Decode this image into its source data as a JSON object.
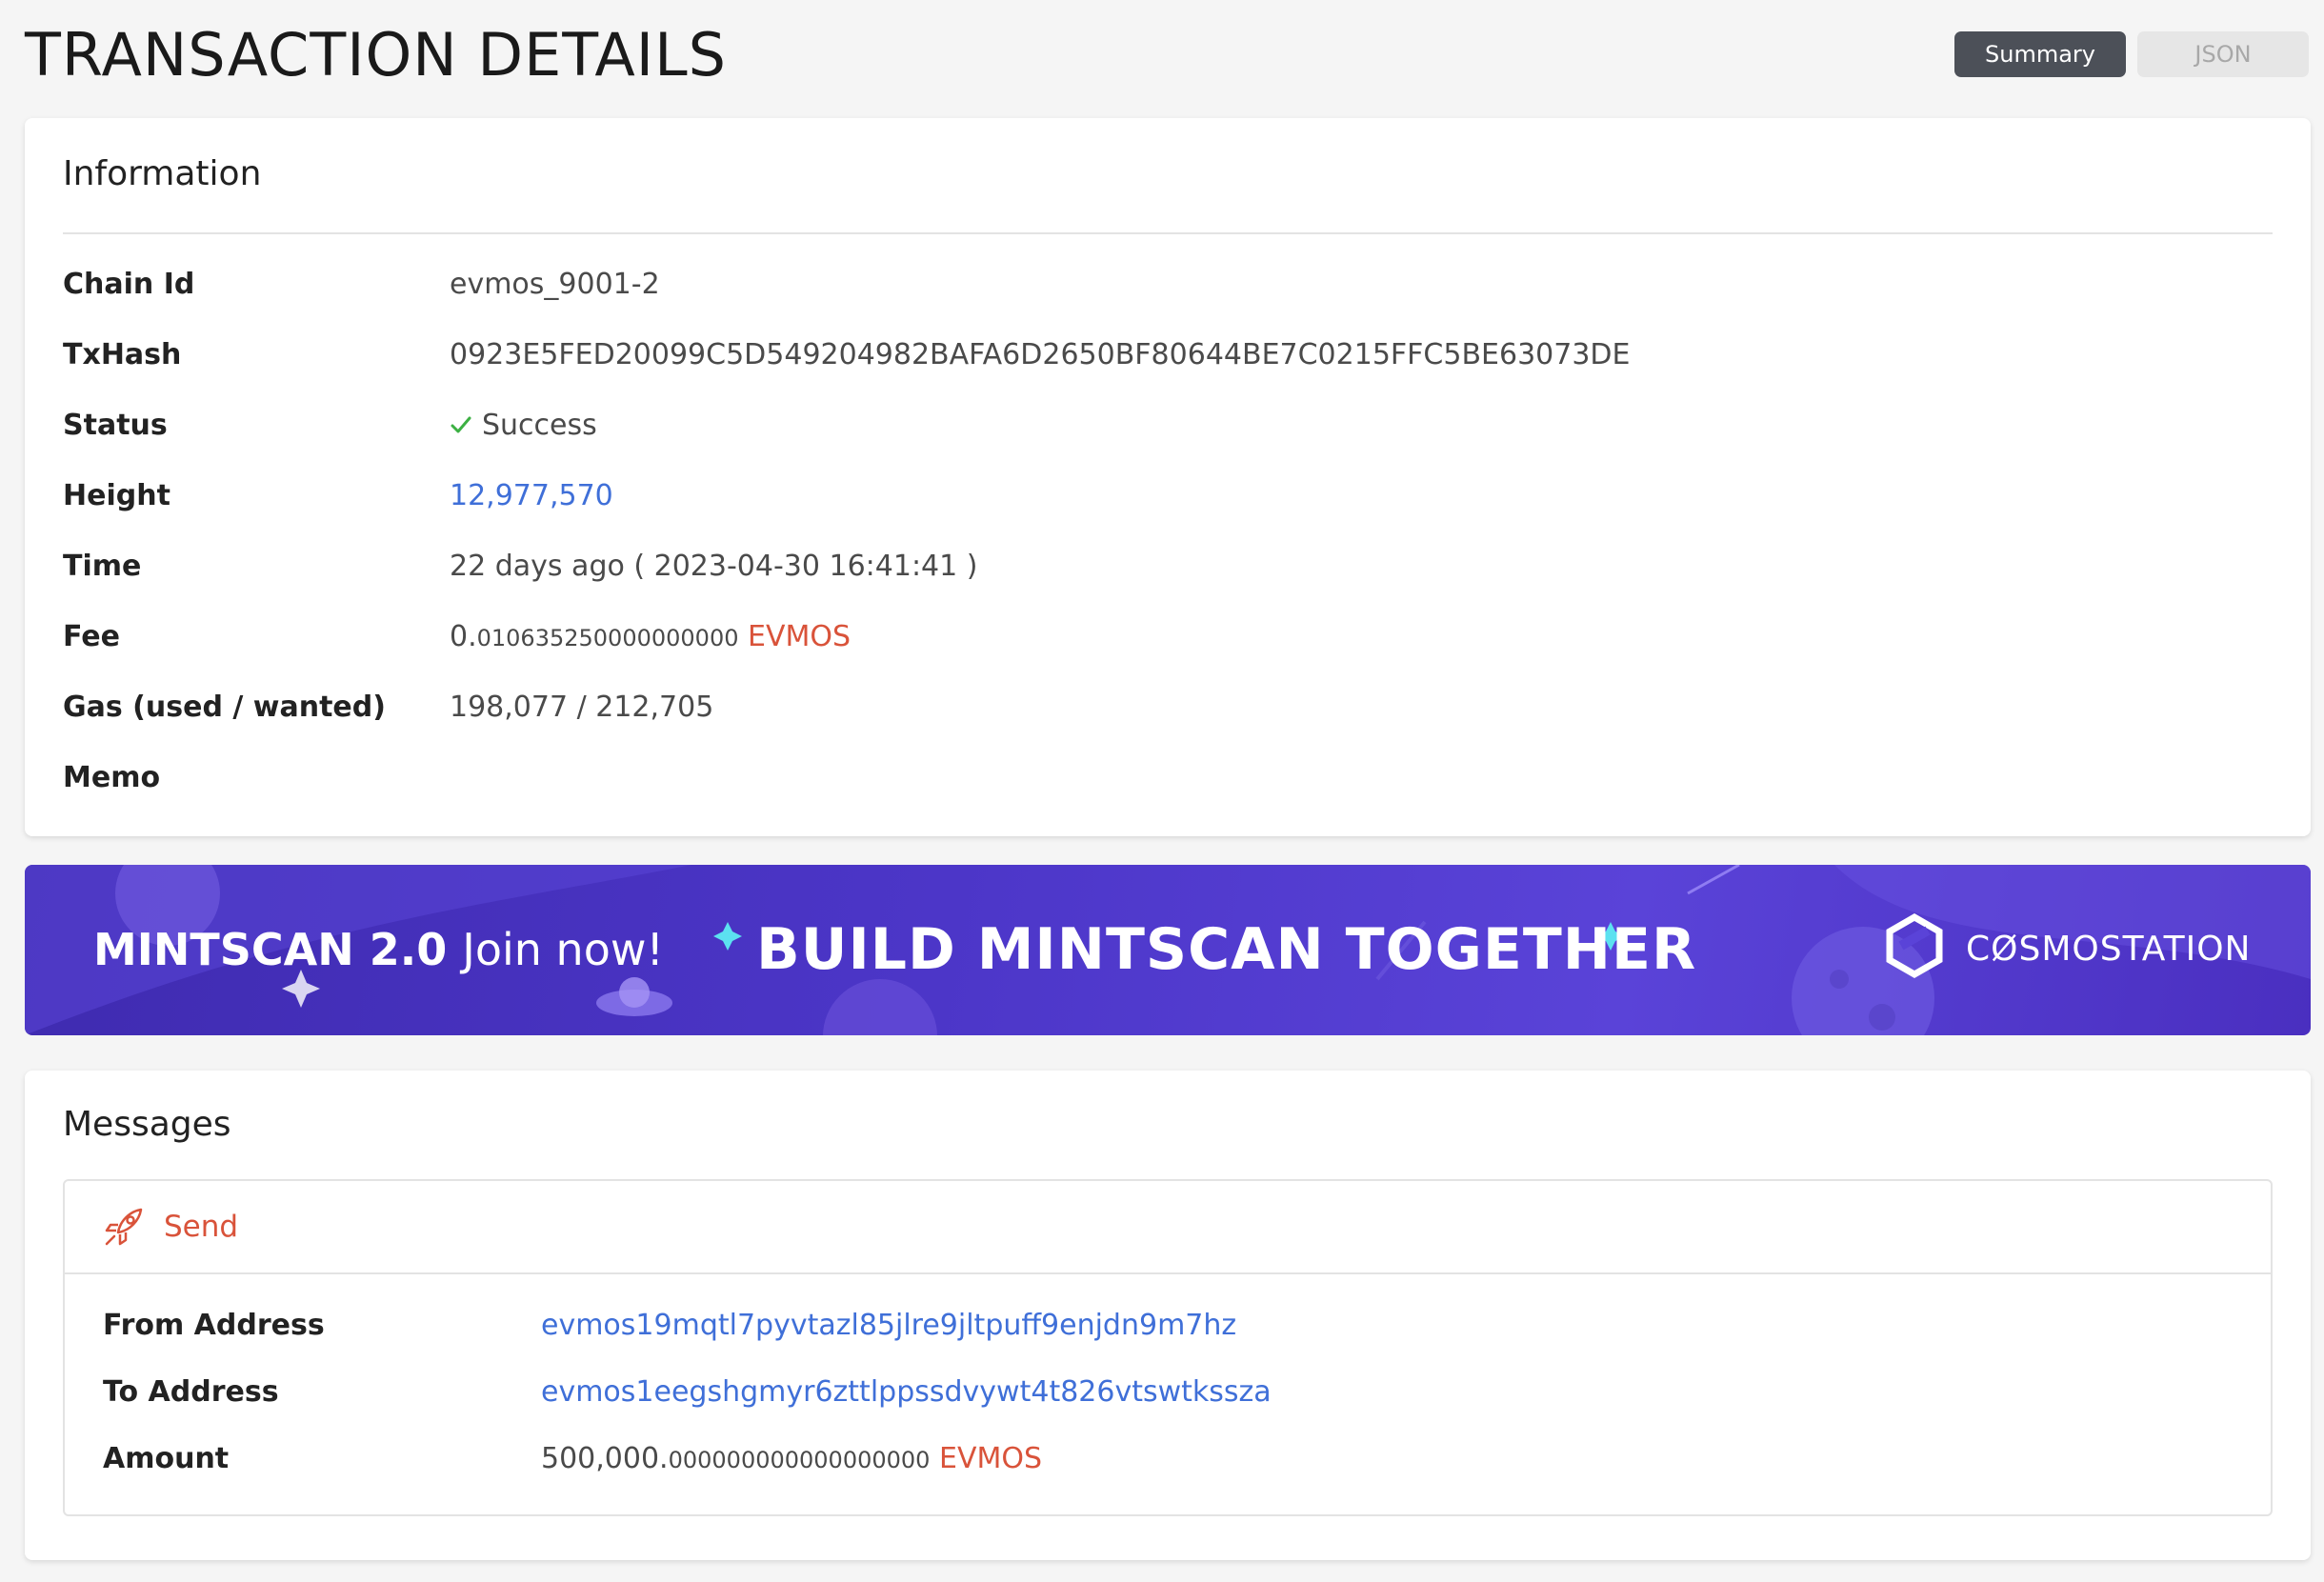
{
  "page": {
    "title": "TRANSACTION DETAILS"
  },
  "view_toggle": {
    "summary": "Summary",
    "json": "JSON",
    "active": "Summary"
  },
  "information": {
    "title": "Information",
    "rows": [
      {
        "label": "Chain Id",
        "value": "evmos_9001-2"
      },
      {
        "label": "TxHash",
        "value": "0923E5FED20099C5D549204982BAFA6D2650BF80644BE7C0215FFC5BE63073DE"
      },
      {
        "label": "Status",
        "value": "Success"
      },
      {
        "label": "Height",
        "value": "12,977,570"
      },
      {
        "label": "Time",
        "value": "22 days ago ( 2023-04-30 16:41:41 )"
      },
      {
        "label": "Fee",
        "value_int": "0.",
        "value_dec": "010635250000000000",
        "denom": "EVMOS"
      },
      {
        "label": "Gas (used / wanted)",
        "value": "198,077 / 212,705"
      },
      {
        "label": "Memo",
        "value": ""
      }
    ]
  },
  "banner": {
    "left_bold": "MINTSCAN 2.0",
    "left_thin": "Join now!",
    "center": "BUILD MINTSCAN TOGETHER",
    "brand": "CØSMOSTATION"
  },
  "messages": {
    "title": "Messages",
    "items": [
      {
        "type": "Send",
        "icon": "rocket-icon",
        "from_label": "From Address",
        "from": "evmos19mqtl7pyvtazl85jlre9jltpuff9enjdn9m7hz",
        "to_label": "To Address",
        "to": "evmos1eegshgmyr6zttlppssdvywt4t826vtswtkssza",
        "amount_label": "Amount",
        "amount_int": "500,000.",
        "amount_dec": "000000000000000000",
        "amount_denom": "EVMOS"
      }
    ]
  },
  "colors": {
    "link": "#3f6fd8",
    "denom": "#d9533a",
    "success": "#3cb043",
    "toggle_active": "#4c5058",
    "banner": "#4c36c8"
  }
}
